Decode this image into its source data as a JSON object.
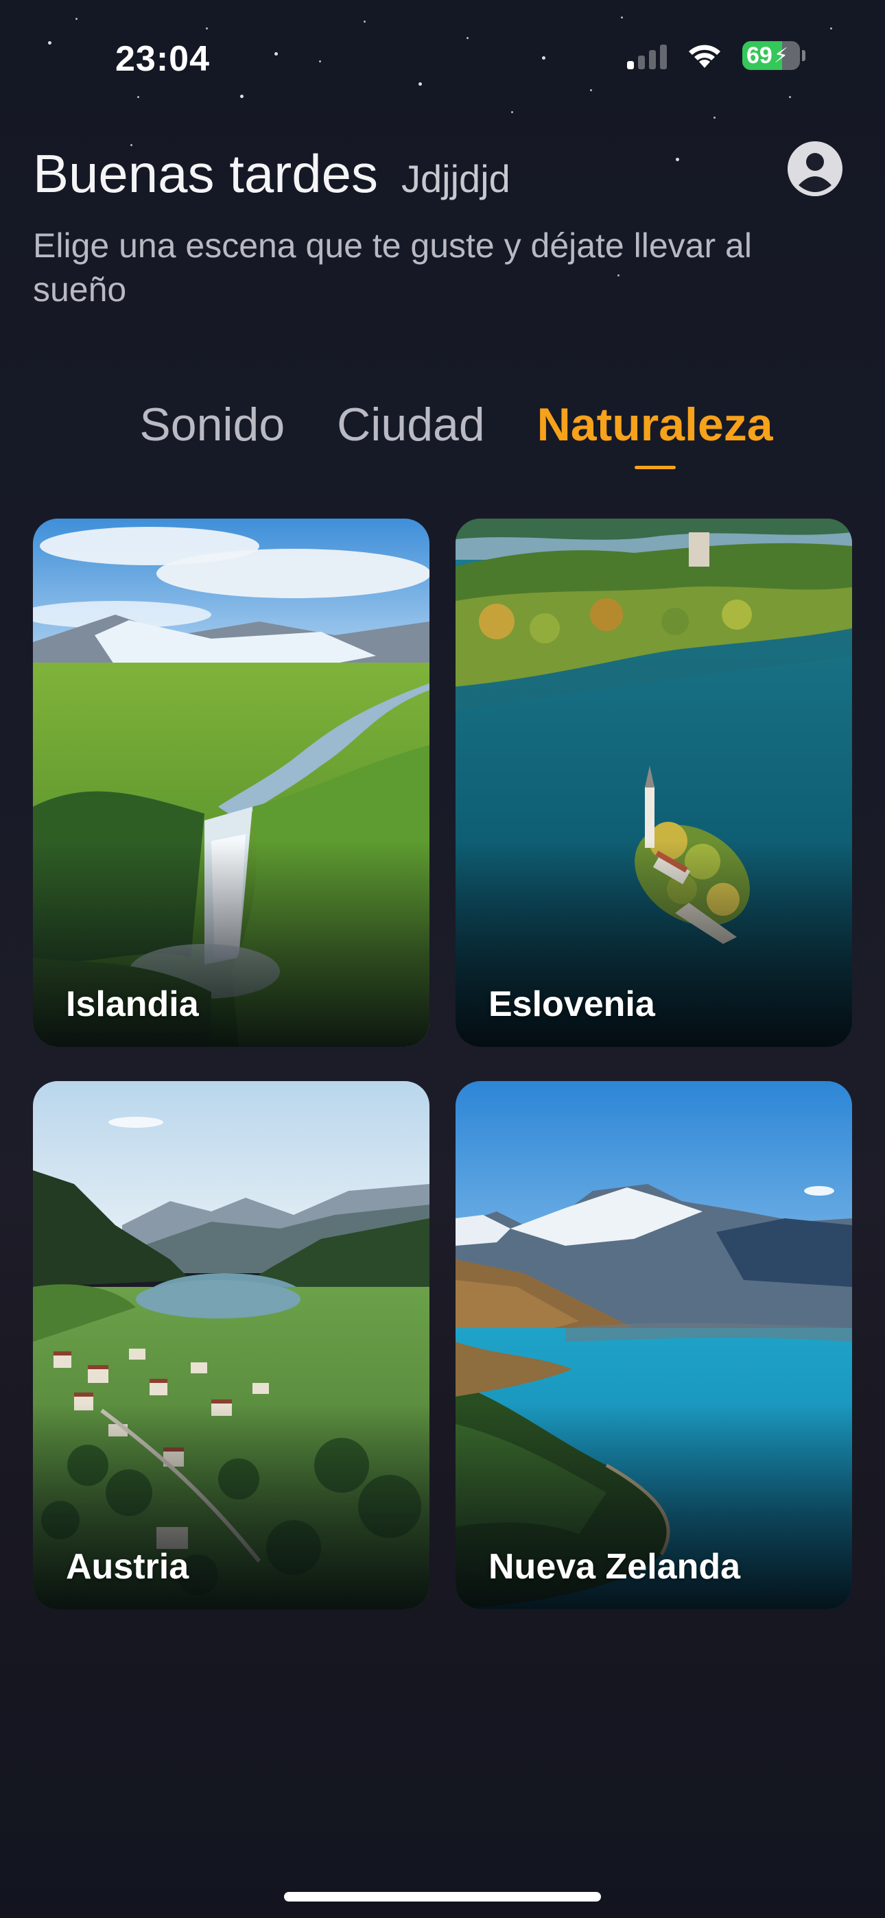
{
  "status_bar": {
    "time": "23:04",
    "battery": "69",
    "battery_level": 0.69
  },
  "header": {
    "greeting": "Buenas tardes",
    "user_name": "Jdjjdjd",
    "subtitle": "Elige una escena que te guste y déjate llevar al sueño"
  },
  "tabs": [
    {
      "label": "Sonido",
      "active": false
    },
    {
      "label": "Ciudad",
      "active": false
    },
    {
      "label": "Naturaleza",
      "active": true
    }
  ],
  "scenes": [
    {
      "label": "Islandia"
    },
    {
      "label": "Eslovenia"
    },
    {
      "label": "Austria"
    },
    {
      "label": "Nueva Zelanda"
    }
  ],
  "colors": {
    "accent": "#f7a21b",
    "background": "#161a26",
    "battery_green": "#34c759"
  },
  "icons": {
    "signal": "cellular-signal-icon",
    "wifi": "wifi-icon",
    "battery": "battery-icon",
    "profile": "user-profile-icon"
  }
}
